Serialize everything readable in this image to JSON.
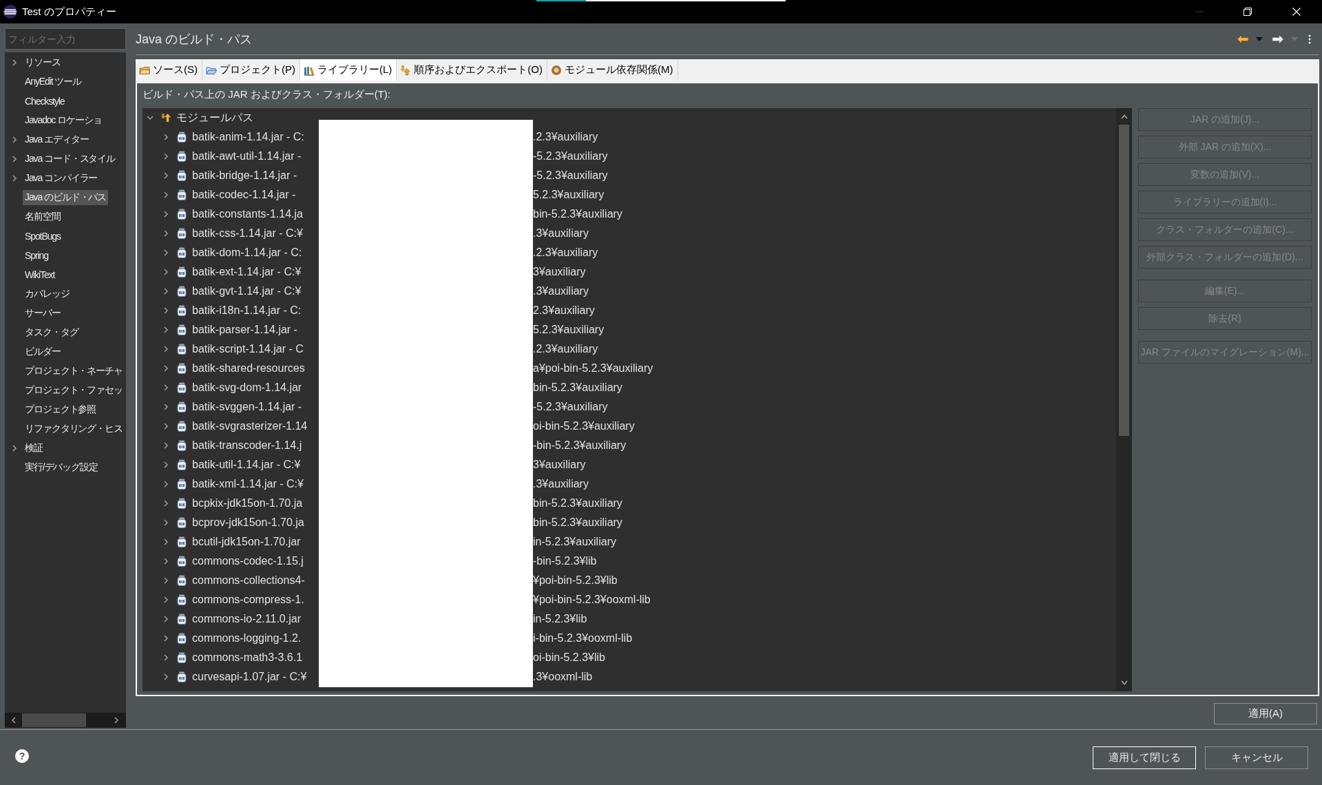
{
  "window": {
    "title": "Test のプロパティー",
    "minimize_disabled": true
  },
  "filter": {
    "placeholder": "フィルター入力"
  },
  "sidebar": {
    "items": [
      {
        "label": "リソース",
        "expandable": true,
        "selected": false
      },
      {
        "label": "AnyEdit ツール",
        "expandable": false,
        "selected": false
      },
      {
        "label": "Checkstyle",
        "expandable": false,
        "selected": false
      },
      {
        "label": "Javadoc ロケーショ",
        "expandable": false,
        "selected": false
      },
      {
        "label": "Java エディター",
        "expandable": true,
        "selected": false
      },
      {
        "label": "Java コード・スタイル",
        "expandable": true,
        "selected": false
      },
      {
        "label": "Java コンパイラー",
        "expandable": true,
        "selected": false
      },
      {
        "label": "Java のビルド・パス",
        "expandable": false,
        "selected": true
      },
      {
        "label": "名前空間",
        "expandable": false,
        "selected": false
      },
      {
        "label": "SpotBugs",
        "expandable": false,
        "selected": false
      },
      {
        "label": "Spring",
        "expandable": false,
        "selected": false
      },
      {
        "label": "WikiText",
        "expandable": false,
        "selected": false
      },
      {
        "label": "カバレッジ",
        "expandable": false,
        "selected": false
      },
      {
        "label": "サーバー",
        "expandable": false,
        "selected": false
      },
      {
        "label": "タスク・タグ",
        "expandable": false,
        "selected": false
      },
      {
        "label": "ビルダー",
        "expandable": false,
        "selected": false
      },
      {
        "label": "プロジェクト・ネーチャ",
        "expandable": false,
        "selected": false
      },
      {
        "label": "プロジェクト・ファセッ",
        "expandable": false,
        "selected": false
      },
      {
        "label": "プロジェクト参照",
        "expandable": false,
        "selected": false
      },
      {
        "label": "リファクタリング・ヒス",
        "expandable": false,
        "selected": false
      },
      {
        "label": "検証",
        "expandable": true,
        "selected": false
      },
      {
        "label": "実行/デバッグ設定",
        "expandable": false,
        "selected": false
      }
    ]
  },
  "page": {
    "title": "Java のビルド・パス",
    "history": {
      "back_menu_disabled": false,
      "forward_menu_disabled": true
    }
  },
  "tabs": [
    {
      "label": "ソース(S)",
      "kind": "source",
      "selected": false
    },
    {
      "label": "プロジェクト(P)",
      "kind": "project",
      "selected": false
    },
    {
      "label": "ライブラリー(L)",
      "kind": "library",
      "selected": true
    },
    {
      "label": "順序およびエクスポート(O)",
      "kind": "order",
      "selected": false
    },
    {
      "label": "モジュール依存関係(M)",
      "kind": "module",
      "selected": false
    }
  ],
  "build_path": {
    "label": "ビルド・パス上の JAR およびクラス・フォルダー(T):",
    "tree": {
      "label": "モジュールパス",
      "expanded": true,
      "children": [
        {
          "start": "batik-anim-1.14.jar - C:",
          "end": ".2.3¥auxiliary",
          "expanded": false
        },
        {
          "start": "batik-awt-util-1.14.jar -",
          "end": "-5.2.3¥auxiliary",
          "expanded": false
        },
        {
          "start": "batik-bridge-1.14.jar -",
          "end": "-5.2.3¥auxiliary",
          "expanded": false
        },
        {
          "start": "batik-codec-1.14.jar -",
          "end": "5.2.3¥auxiliary",
          "expanded": false
        },
        {
          "start": "batik-constants-1.14.ja",
          "end": "bin-5.2.3¥auxiliary",
          "expanded": false
        },
        {
          "start": "batik-css-1.14.jar - C:¥",
          "end": ".3¥auxiliary",
          "expanded": false
        },
        {
          "start": "batik-dom-1.14.jar - C:",
          "end": ".2.3¥auxiliary",
          "expanded": false
        },
        {
          "start": "batik-ext-1.14.jar - C:¥",
          "end": "3¥auxiliary",
          "expanded": false
        },
        {
          "start": "batik-gvt-1.14.jar - C:¥",
          "end": ".3¥auxiliary",
          "expanded": false
        },
        {
          "start": "batik-i18n-1.14.jar - C:",
          "end": "2.3¥auxiliary",
          "expanded": false
        },
        {
          "start": "batik-parser-1.14.jar -",
          "end": "5.2.3¥auxiliary",
          "expanded": false
        },
        {
          "start": "batik-script-1.14.jar - C",
          "end": ".2.3¥auxiliary",
          "expanded": false
        },
        {
          "start": "batik-shared-resources",
          "end": "a¥poi-bin-5.2.3¥auxiliary",
          "expanded": false
        },
        {
          "start": "batik-svg-dom-1.14.jar",
          "end": "bin-5.2.3¥auxiliary",
          "expanded": false
        },
        {
          "start": "batik-svggen-1.14.jar -",
          "end": "-5.2.3¥auxiliary",
          "expanded": false
        },
        {
          "start": "batik-svgrasterizer-1.14",
          "end": "oi-bin-5.2.3¥auxiliary",
          "expanded": false
        },
        {
          "start": "batik-transcoder-1.14.j",
          "end": "-bin-5.2.3¥auxiliary",
          "expanded": false
        },
        {
          "start": "batik-util-1.14.jar - C:¥",
          "end": "3¥auxiliary",
          "expanded": false
        },
        {
          "start": "batik-xml-1.14.jar - C:¥",
          "end": ".3¥auxiliary",
          "expanded": false
        },
        {
          "start": "bcpkix-jdk15on-1.70.ja",
          "end": "bin-5.2.3¥auxiliary",
          "expanded": false
        },
        {
          "start": "bcprov-jdk15on-1.70.ja",
          "end": "bin-5.2.3¥auxiliary",
          "expanded": false
        },
        {
          "start": "bcutil-jdk15on-1.70.jar",
          "end": "in-5.2.3¥auxiliary",
          "expanded": false
        },
        {
          "start": "commons-codec-1.15.j",
          "end": "-bin-5.2.3¥lib",
          "expanded": false
        },
        {
          "start": "commons-collections4-",
          "end": "¥poi-bin-5.2.3¥lib",
          "expanded": false
        },
        {
          "start": "commons-compress-1.",
          "end": "¥poi-bin-5.2.3¥ooxml-lib",
          "expanded": false
        },
        {
          "start": "commons-io-2.11.0.jar",
          "end": "in-5.2.3¥lib",
          "expanded": false
        },
        {
          "start": "commons-logging-1.2.",
          "end": "i-bin-5.2.3¥ooxml-lib",
          "expanded": false
        },
        {
          "start": "commons-math3-3.6.1",
          "end": "oi-bin-5.2.3¥lib",
          "expanded": false
        },
        {
          "start": "curvesapi-1.07.jar - C:¥",
          "end": ".3¥ooxml-lib",
          "expanded": false
        }
      ]
    },
    "button_groups": [
      [
        {
          "label": "JAR の追加(J)...",
          "disabled": true
        },
        {
          "label": "外部 JAR の追加(X)...",
          "disabled": true
        },
        {
          "label": "変数の追加(V)...",
          "disabled": true
        },
        {
          "label": "ライブラリーの追加(I)...",
          "disabled": true
        },
        {
          "label": "クラス・フォルダーの追加(C)...",
          "disabled": true
        },
        {
          "label": "外部クラス・フォルダーの追加(D)...",
          "disabled": true
        }
      ],
      [
        {
          "label": "編集(E)...",
          "disabled": true
        },
        {
          "label": "除去(R)",
          "disabled": true
        }
      ],
      [
        {
          "label": "JAR ファイルのマイグレーション(M)...",
          "disabled": true
        }
      ]
    ]
  },
  "apply_button": {
    "label": "適用(A)",
    "disabled": false
  },
  "footer": {
    "help_icon": "?",
    "buttons": [
      {
        "label": "適用して閉じる",
        "default": true
      },
      {
        "label": "キャンセル",
        "default": false
      }
    ]
  }
}
